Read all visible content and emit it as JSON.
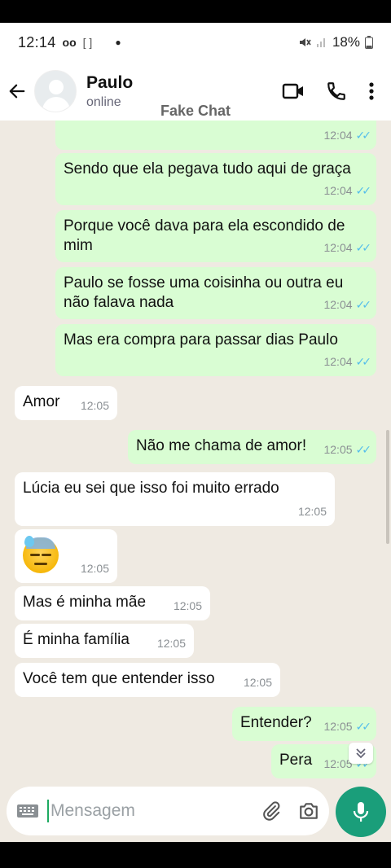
{
  "status_bar": {
    "time": "12:14",
    "battery": "18%"
  },
  "header": {
    "name": "Paulo",
    "status": "online"
  },
  "watermark": "Fake Chat",
  "messages": [
    {
      "dir": "out",
      "text": "",
      "time": "12:04",
      "read": true
    },
    {
      "dir": "out",
      "text": "Sendo que ela pegava tudo aqui de graça",
      "time": "12:04",
      "read": true
    },
    {
      "dir": "out",
      "text": "Porque você dava para ela escondido de mim",
      "time": "12:04",
      "read": true
    },
    {
      "dir": "out",
      "text": "Paulo se fosse uma coisinha ou outra eu não falava nada",
      "time": "12:04",
      "read": true
    },
    {
      "dir": "out",
      "text": "Mas era compra para passar dias Paulo",
      "time": "12:04",
      "read": true
    },
    {
      "dir": "in",
      "text": "Amor",
      "time": "12:05"
    },
    {
      "dir": "out",
      "text": "Não me chama de amor!",
      "time": "12:05",
      "read": true
    },
    {
      "dir": "in",
      "text": "Lúcia eu sei que isso foi muito errado",
      "time": "12:05"
    },
    {
      "dir": "in",
      "text": "",
      "emoji": "downcast-face-with-sweat",
      "time": "12:05"
    },
    {
      "dir": "in",
      "text": "Mas é minha mãe",
      "time": "12:05"
    },
    {
      "dir": "in",
      "text": "É minha família",
      "time": "12:05"
    },
    {
      "dir": "in",
      "text": "Você tem que entender isso",
      "time": "12:05"
    },
    {
      "dir": "out",
      "text": "Entender?",
      "time": "12:05",
      "read": true
    },
    {
      "dir": "out",
      "text": "Pera",
      "time": "12:05",
      "read": true
    }
  ],
  "composer": {
    "placeholder": "Mensagem"
  },
  "colors": {
    "outgoing": "#d9fdd3",
    "incoming": "#ffffff",
    "background": "#efeae2",
    "accent": "#1a9e7a",
    "ticks": "#53bdeb"
  }
}
